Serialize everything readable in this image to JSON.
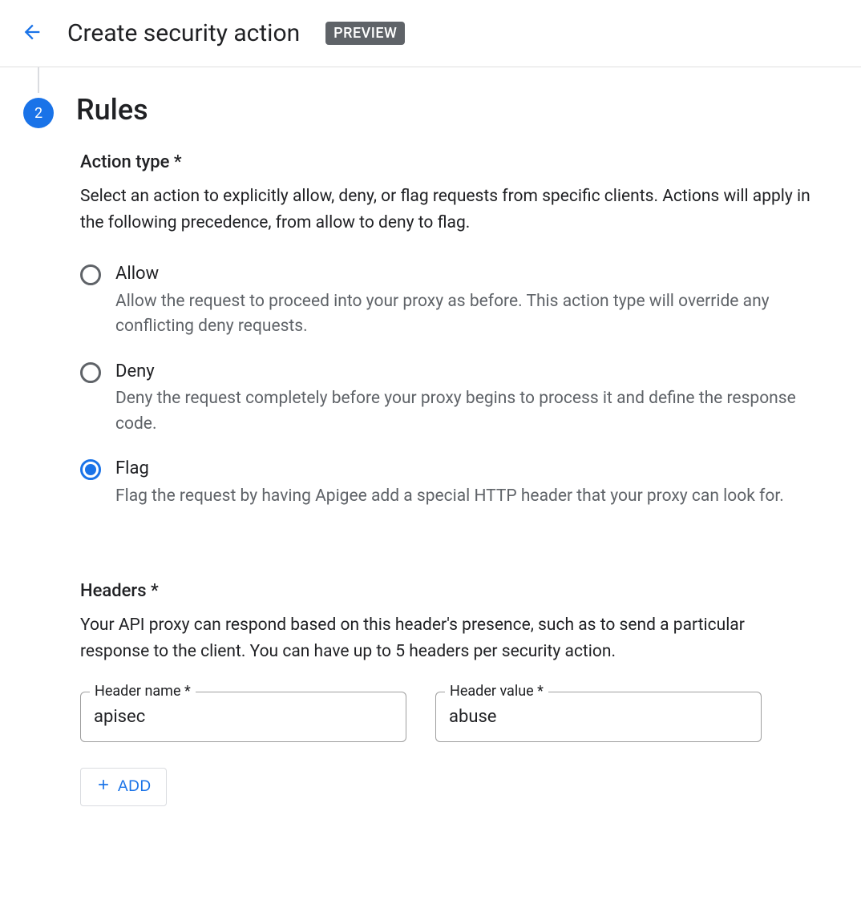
{
  "header": {
    "title": "Create security action",
    "badge": "PREVIEW"
  },
  "step": {
    "number": "2",
    "title": "Rules"
  },
  "actionType": {
    "label": "Action type *",
    "help": "Select an action to explicitly allow, deny, or flag requests from specific clients. Actions will apply in the following precedence, from allow to deny to flag.",
    "selected": "flag",
    "options": [
      {
        "id": "allow",
        "label": "Allow",
        "desc": "Allow the request to proceed into your proxy as before. This action type will override any conflicting deny requests."
      },
      {
        "id": "deny",
        "label": "Deny",
        "desc": "Deny the request completely before your proxy begins to process it and define the response code."
      },
      {
        "id": "flag",
        "label": "Flag",
        "desc": "Flag the request by having Apigee add a special HTTP header that your proxy can look for."
      }
    ]
  },
  "headers": {
    "label": "Headers *",
    "help": "Your API proxy can respond based on this header's presence, such as to send a particular response to the client. You can have up to 5 headers per security action.",
    "nameLabel": "Header name *",
    "valueLabel": "Header value *",
    "rows": [
      {
        "name": "apisec",
        "value": "abuse"
      }
    ],
    "addLabel": "ADD"
  }
}
